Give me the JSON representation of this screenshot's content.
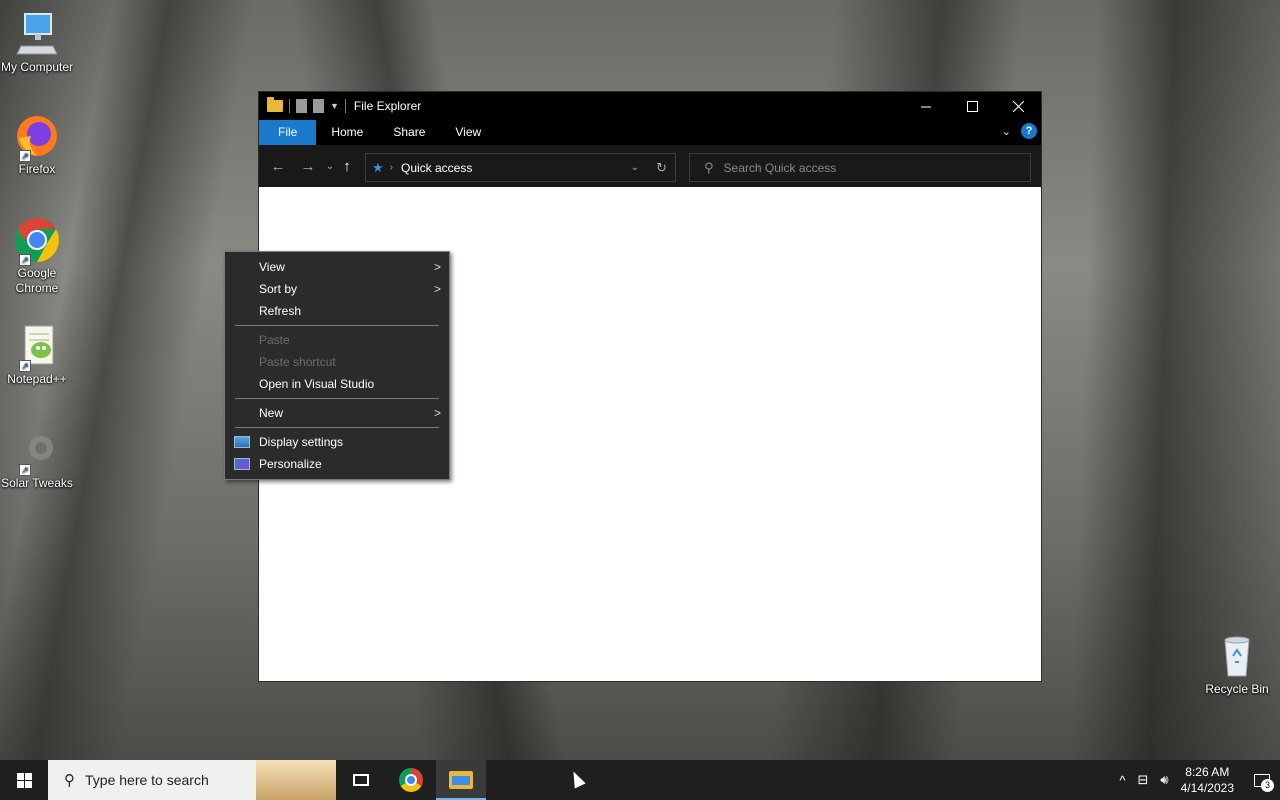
{
  "desktop": {
    "icons": [
      {
        "label": "My Computer",
        "icon": "computer-icon"
      },
      {
        "label": "Firefox",
        "icon": "firefox-icon"
      },
      {
        "label": "Google Chrome",
        "icon": "chrome-icon"
      },
      {
        "label": "Notepad++",
        "icon": "notepad-plus-plus-icon"
      },
      {
        "label": "Solar Tweaks",
        "icon": "solar-tweaks-icon"
      },
      {
        "label": "Recycle Bin",
        "icon": "recycle-bin-icon"
      }
    ]
  },
  "explorer": {
    "title": "File Explorer",
    "tabs": [
      {
        "label": "File"
      },
      {
        "label": "Home"
      },
      {
        "label": "Share"
      },
      {
        "label": "View"
      }
    ],
    "address": "Quick access",
    "search_placeholder": "Search Quick access",
    "colors": {
      "file_tab": "#1979ca",
      "titlebar": "#000000"
    }
  },
  "context_menu": {
    "items": [
      {
        "label": "View",
        "submenu": true,
        "enabled": true
      },
      {
        "label": "Sort by",
        "submenu": true,
        "enabled": true
      },
      {
        "label": "Refresh",
        "submenu": false,
        "enabled": true
      },
      {
        "label": "Paste",
        "submenu": false,
        "enabled": false
      },
      {
        "label": "Paste shortcut",
        "submenu": false,
        "enabled": false
      },
      {
        "label": "Open in Visual Studio",
        "submenu": false,
        "enabled": true
      },
      {
        "label": "New",
        "submenu": true,
        "enabled": true
      },
      {
        "label": "Display settings",
        "submenu": false,
        "enabled": true,
        "icon": "display-settings-icon"
      },
      {
        "label": "Personalize",
        "submenu": false,
        "enabled": true,
        "icon": "personalize-icon"
      }
    ]
  },
  "taskbar": {
    "search_placeholder": "Type here to search",
    "clock_time": "8:26 AM",
    "clock_date": "4/14/2023",
    "notification_count": "3"
  }
}
